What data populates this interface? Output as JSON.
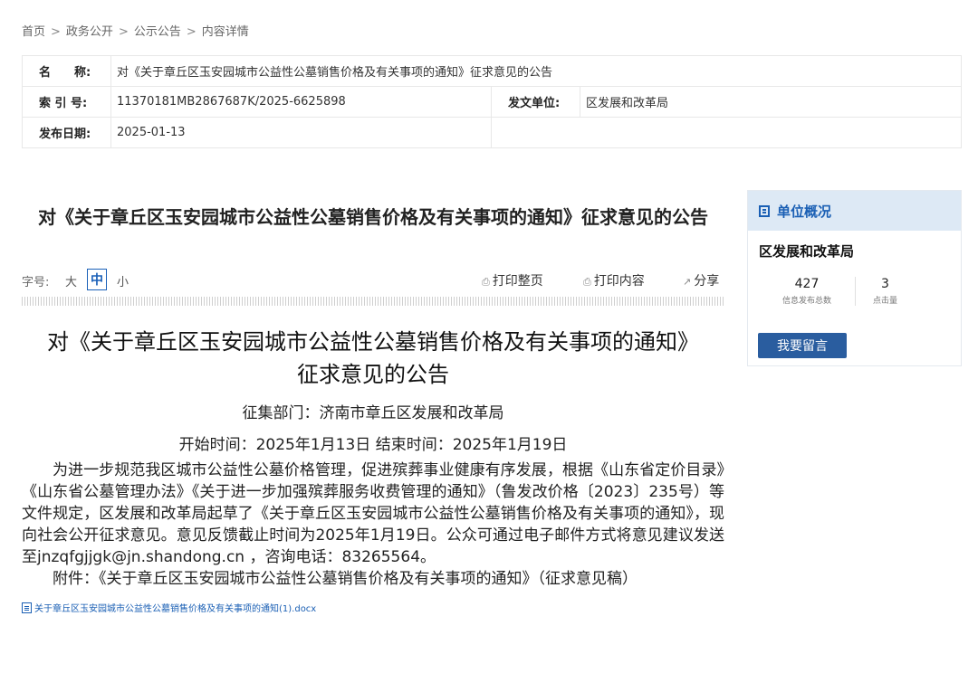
{
  "breadcrumb": {
    "items": [
      "首页",
      "政务公开",
      "公示公告",
      "内容详情"
    ],
    "separator": ">"
  },
  "meta": {
    "name_label": "名　　称:",
    "name_value": "对《关于章丘区玉安园城市公益性公墓销售价格及有关事项的通知》征求意见的公告",
    "index_label": "索 引 号:",
    "index_value": "11370181MB2867687K/2025-6625898",
    "issuer_label": "发文单位:",
    "issuer_value": "区发展和改革局",
    "date_label": "发布日期:",
    "date_value": "2025-01-13"
  },
  "article": {
    "title": "对《关于章丘区玉安园城市公益性公墓销售价格及有关事项的通知》征求意见的公告"
  },
  "toolbar": {
    "font_size_label": "字号:",
    "size_large": "大",
    "size_medium": "中",
    "size_small": "小",
    "print_page": "打印整页",
    "print_content": "打印内容",
    "share": "分享"
  },
  "content": {
    "title_line1": "对《关于章丘区玉安园城市公益性公墓销售价格及有关事项的通知》",
    "title_line2": "征求意见的公告",
    "department": "征集部门：济南市章丘区发展和改革局",
    "time": "开始时间：2025年1月13日  结束时间：2025年1月19日",
    "paragraph": "为进一步规范我区城市公益性公墓价格管理，促进殡葬事业健康有序发展，根据《山东省定价目录》《山东省公墓管理办法》《关于进一步加强殡葬服务收费管理的通知》（鲁发改价格〔2023〕235号）等文件规定，区发展和改革局起草了《关于章丘区玉安园城市公益性公墓销售价格及有关事项的通知》，现向社会公开征求意见。意见反馈截止时间为2025年1月19日。公众可通过电子邮件方式将意见建议发送至jnzqfgjjgk@jn.shandong.cn ，咨询电话：83265564。",
    "attachment_line": "附件：《关于章丘区玉安园城市公益性公墓销售价格及有关事项的通知》（征求意见稿）",
    "file_link": "关于章丘区玉安园城市公益性公墓销售价格及有关事项的通知(1).docx"
  },
  "sidebar": {
    "header": "单位概况",
    "unit_name": "区发展和改革局",
    "stat1_value": "427",
    "stat1_label": "信息发布总数",
    "stat2_value": "3",
    "stat2_label": "点击量",
    "message_button": "我要留言"
  },
  "colors": {
    "accent": "#1a5fb4",
    "button": "#2a5d9f",
    "sidebar_header_bg": "#dde9f5"
  }
}
